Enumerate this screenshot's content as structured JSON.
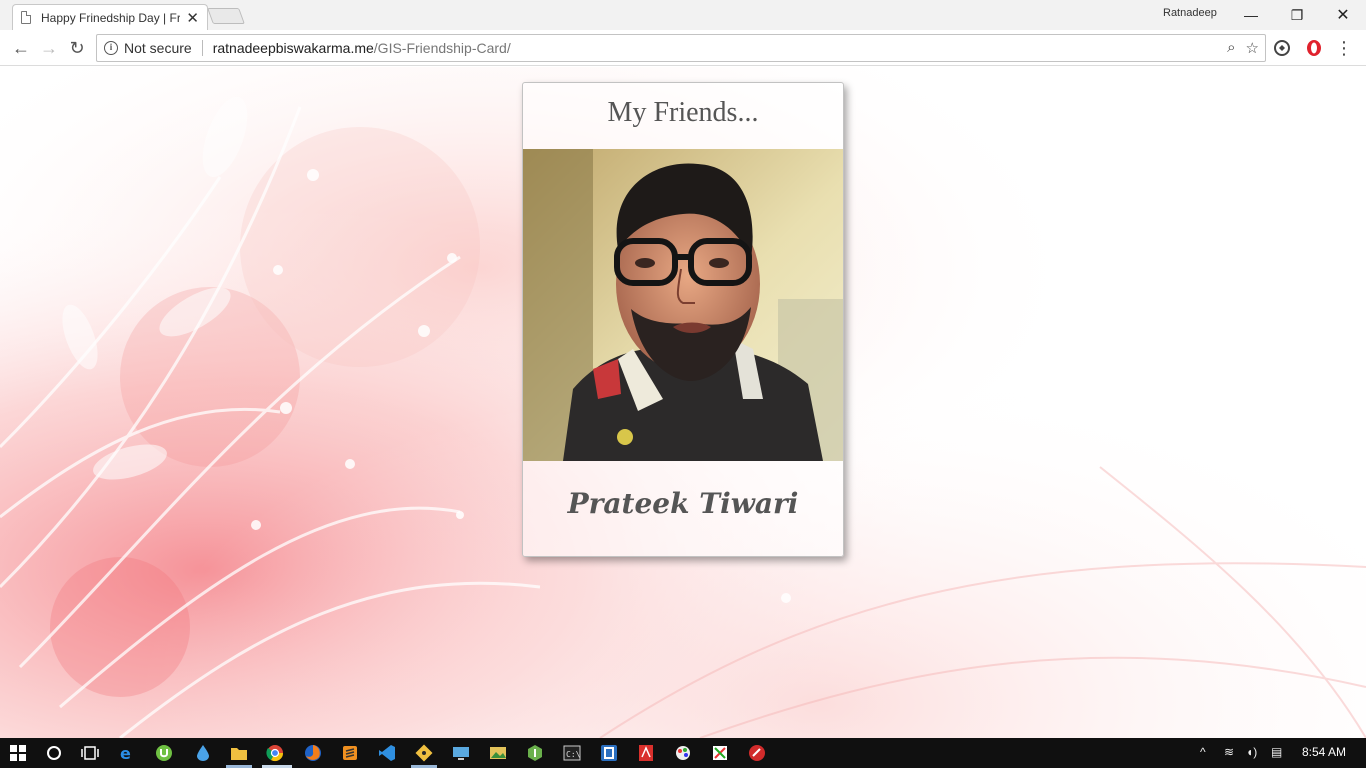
{
  "browser": {
    "tab_title": "Happy Frinedship Day | Fr",
    "tab_close": "✕",
    "profile_name": "Ratnadeep",
    "window_controls": {
      "minimize": "—",
      "restore": "❐",
      "close": "✕"
    },
    "nav": {
      "back": "←",
      "forward": "→",
      "reload": "↻"
    },
    "security_text": "Not secure",
    "url_domain": "ratnadeepbiswakarma.me",
    "url_path": "/GIS-Friendship-Card/",
    "omnibox_icons": {
      "zoom": "⌕",
      "bookmark": "☆"
    },
    "menu": "⋮"
  },
  "page": {
    "card_title": "My Friends...",
    "friend_name": "Prateek Tiwari"
  },
  "taskbar": {
    "time": "8:54 AM",
    "tray": {
      "chevron": "^",
      "wifi": "≋",
      "volume": "◖)",
      "notifications": "▤"
    }
  },
  "colors": {
    "accent_text": "#555555",
    "taskbar": "#101010",
    "background_pink": "#f9b8b8"
  }
}
